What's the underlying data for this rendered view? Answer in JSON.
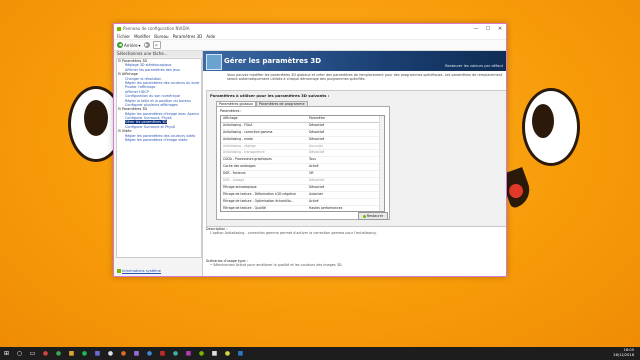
{
  "window": {
    "title": "Panneau de configuration NVIDIA",
    "controls": [
      "—",
      "☐",
      "✕"
    ]
  },
  "menu": [
    "Fichier",
    "Modifier",
    "Bureau",
    "Paramètres 3D",
    "Aide"
  ],
  "toolbar": {
    "back_label": "Arrière",
    "back_arrow": "▾"
  },
  "sidebar": {
    "header": "Sélectionnez une tâche...",
    "tree": [
      {
        "label": "Paramètres 3D",
        "type": "cat"
      },
      {
        "label": "Réglage 3D stéréoscopique",
        "type": "item"
      },
      {
        "label": "Afficher les paramètres des jeux",
        "type": "item"
      },
      {
        "label": "Affichage",
        "type": "cat"
      },
      {
        "label": "Changer la résolution",
        "type": "item"
      },
      {
        "label": "Régler les paramètres des couleurs du bure",
        "type": "item"
      },
      {
        "label": "Pivoter l'affichage",
        "type": "item"
      },
      {
        "label": "Afficher HDCP",
        "type": "item"
      },
      {
        "label": "Configuration du son numérique",
        "type": "item"
      },
      {
        "label": "Régler la taille et la position du bureau",
        "type": "item"
      },
      {
        "label": "Configurer plusieurs affichages",
        "type": "item"
      },
      {
        "label": "Paramètres 3D",
        "type": "cat"
      },
      {
        "label": "Régler les paramètres d'image avec Apercu",
        "type": "item"
      },
      {
        "label": "Configurer Surround, PhysX",
        "type": "item"
      },
      {
        "label": "Gérer les paramètres 3D",
        "type": "sel"
      },
      {
        "label": "Configurer Surround et PhysX",
        "type": "item"
      },
      {
        "label": "Vidéo",
        "type": "cat"
      },
      {
        "label": "Régler les paramètres des couleurs vidéo",
        "type": "item"
      },
      {
        "label": "Régler les paramètres d'image vidéo",
        "type": "item"
      }
    ],
    "system_info": "Informations système"
  },
  "main": {
    "title": "Gérer les paramètres 3D",
    "restore_link": "Restaurer les valeurs par défaut",
    "description": "Vous pouvez modifier les paramètres 3D globaux et créer des paramètres de remplacement pour des programmes spécifiques. Les paramètres de remplacement seront automatiquement utilisés à chaque démarrage des programmes spécifiés.",
    "panel_title": "Paramètres à utiliser pour les paramètres 3D suivants :",
    "tabs": [
      "Paramètres globaux",
      "Paramètres de programme"
    ],
    "settings_label": "Paramètres :",
    "columns": [
      "Affichage",
      "Paramètre"
    ],
    "rows": [
      {
        "feature": "Antialiasing - FXAA",
        "value": "Désactivé",
        "dim": false
      },
      {
        "feature": "Antialiasing - correction gamma",
        "value": "Désactivé",
        "dim": false
      },
      {
        "feature": "Antialiasing - mode",
        "value": "Désactivé",
        "dim": false
      },
      {
        "feature": "Antialiasing - réglage",
        "value": "Aucun(e)",
        "dim": true
      },
      {
        "feature": "Antialiasing - transparence",
        "value": "Désactivé",
        "dim": true
      },
      {
        "feature": "CUDA - Processeurs graphiques",
        "value": "Tous",
        "dim": false
      },
      {
        "feature": "Cache des ombrages",
        "value": "Activé",
        "dim": false
      },
      {
        "feature": "DSR - Facteurs",
        "value": "Off",
        "dim": false
      },
      {
        "feature": "DSR - Lissage",
        "value": "Désactivé",
        "dim": true
      },
      {
        "feature": "Filtrage anisotropique",
        "value": "Désactivé",
        "dim": false
      },
      {
        "feature": "Filtrage de texture - Déformation LOD négative",
        "value": "Autoriser",
        "dim": false
      },
      {
        "feature": "Filtrage de texture - Optimisation échantillo...",
        "value": "Activé",
        "dim": false
      },
      {
        "feature": "Filtrage de texture - Qualité",
        "value": "Hautes performances",
        "dim": false
      }
    ],
    "restore_button": "Restaurer",
    "description_label": "Description :",
    "description_text": "L'option Antialiasing - correction gamma permet d'activer la correction gamma pour l'antialiasing.",
    "usage_label": "Scénarios d'usage type :",
    "usage_text": "• Sélectionnez Activé pour améliorer la qualité et les couleurs des images 3D."
  },
  "taskbar": {
    "icons": [
      {
        "name": "start-icon",
        "glyph": "⊞",
        "color": "#ffffff"
      },
      {
        "name": "search-icon",
        "glyph": "○",
        "color": "#ffffff"
      },
      {
        "name": "task-view-icon",
        "glyph": "▭",
        "color": "#ffffff"
      },
      {
        "name": "app-icon-1",
        "glyph": "●",
        "color": "#d9433d"
      },
      {
        "name": "app-icon-2",
        "glyph": "●",
        "color": "#3aa657"
      },
      {
        "name": "app-icon-3",
        "glyph": "■",
        "color": "#e0a43a"
      },
      {
        "name": "app-icon-4",
        "glyph": "●",
        "color": "#1db954"
      },
      {
        "name": "app-icon-5",
        "glyph": "■",
        "color": "#6b6bd6"
      },
      {
        "name": "app-icon-6",
        "glyph": "●",
        "color": "#e0e0e0"
      },
      {
        "name": "app-icon-7",
        "glyph": "●",
        "color": "#e06b2b"
      },
      {
        "name": "app-icon-8",
        "glyph": "■",
        "color": "#9c6bd9"
      },
      {
        "name": "app-icon-9",
        "glyph": "●",
        "color": "#3a8ad9"
      },
      {
        "name": "app-icon-10",
        "glyph": "■",
        "color": "#c02c2c"
      },
      {
        "name": "app-icon-11",
        "glyph": "●",
        "color": "#40b0a6"
      },
      {
        "name": "app-icon-12",
        "glyph": "■",
        "color": "#b23bb0"
      },
      {
        "name": "app-icon-13",
        "glyph": "●",
        "color": "#76b900"
      },
      {
        "name": "app-icon-14",
        "glyph": "■",
        "color": "#e0e0e0"
      },
      {
        "name": "app-icon-15",
        "glyph": "●",
        "color": "#d9d93a"
      },
      {
        "name": "app-icon-16",
        "glyph": "■",
        "color": "#2c7ac0"
      }
    ],
    "time": "18:05",
    "date": "26/12/2018"
  },
  "colors": {
    "accent": "#0a2e7a",
    "nvidia_green": "#76b900",
    "link": "#2554b0",
    "desktop": "#f79a08"
  }
}
